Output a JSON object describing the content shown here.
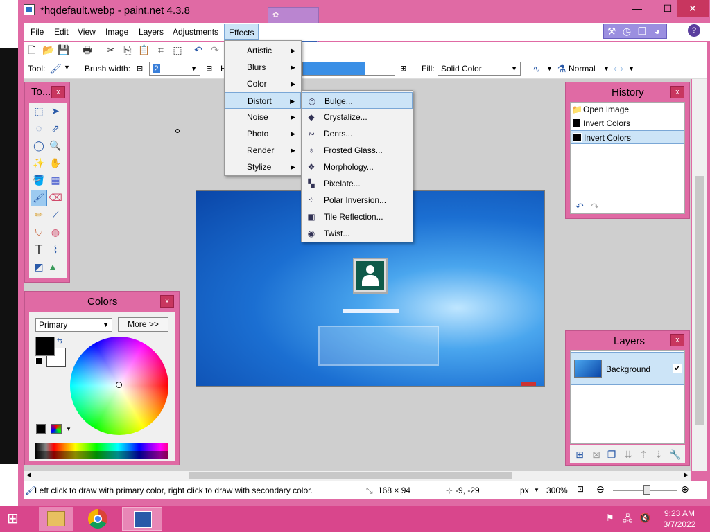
{
  "window": {
    "title": "*hqdefault.webp - paint.net 4.3.8",
    "minimize": "—",
    "maximize": "☐",
    "close": "✕"
  },
  "menu": {
    "items": [
      "File",
      "Edit",
      "View",
      "Image",
      "Layers",
      "Adjustments",
      "Effects"
    ]
  },
  "effects_menu": {
    "items": [
      "Artistic",
      "Blurs",
      "Color",
      "Distort",
      "Noise",
      "Photo",
      "Render",
      "Stylize"
    ],
    "active": "Distort"
  },
  "distort_submenu": {
    "items": [
      "Bulge...",
      "Crystalize...",
      "Dents...",
      "Frosted Glass...",
      "Morphology...",
      "Pixelate...",
      "Polar Inversion...",
      "Tile Reflection...",
      "Twist..."
    ]
  },
  "toolbar": {
    "tool_label": "Tool:",
    "brush_width_label": "Brush width:",
    "brush_width_value": "2",
    "h_label": "H",
    "fill_label": "Fill:",
    "fill_value": "Solid Color",
    "blend_value": "Normal"
  },
  "tools_panel": {
    "title": "To...",
    "close": "x"
  },
  "history_panel": {
    "title": "History",
    "close": "x",
    "items": [
      "Open Image",
      "Invert Colors",
      "Invert Colors"
    ]
  },
  "layers_panel": {
    "title": "Layers",
    "close": "x",
    "layer_name": "Background"
  },
  "colors_panel": {
    "title": "Colors",
    "close": "x",
    "mode": "Primary",
    "more_button": "More >>"
  },
  "status": {
    "hint": "Left click to draw with primary color, right click to draw with secondary color.",
    "selection_size": "168 × 94",
    "cursor": "-9, -29",
    "unit": "px",
    "zoom": "300%"
  },
  "taskbar": {
    "time": "9:23 AM",
    "date": "3/7/2022"
  },
  "colors": {
    "accent": "#e06aa4",
    "menu_highlight": "#cce4f7"
  }
}
